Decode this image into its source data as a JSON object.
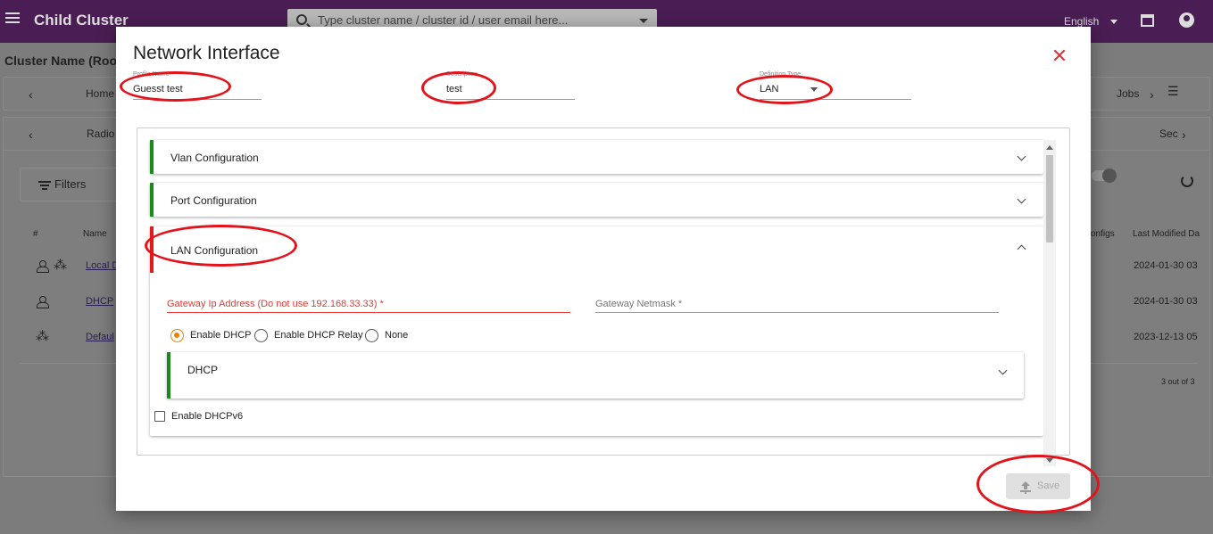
{
  "app": {
    "title": "Child Cluster",
    "search_placeholder": "Type cluster name / cluster id / user email here...",
    "language": "English"
  },
  "background": {
    "breadcrumb": "Cluster Name (Root)",
    "tabs_row1": {
      "first": "Home",
      "last": "Jobs"
    },
    "tabs_row2": {
      "first": "Radio",
      "last": "Sec"
    },
    "filters_label": "Filters",
    "columns": {
      "index": "#",
      "name": "Name",
      "configs": "onfigs",
      "last_modified": "Last Modified Da"
    },
    "rows": [
      {
        "name": "Local D",
        "date": "2024-01-30 03"
      },
      {
        "name": "DHCP",
        "date": "2024-01-30 03"
      },
      {
        "name": "Defaul",
        "date": "2023-12-13 05"
      }
    ],
    "pager": "3 out of 3"
  },
  "modal": {
    "title": "Network Interface",
    "fields": {
      "name": {
        "label": "Profile Name",
        "value": "Guesst test"
      },
      "description": {
        "label": "Description",
        "value": "test"
      },
      "type": {
        "label": "Definition Type",
        "value": "LAN"
      }
    },
    "sections": {
      "vlan": "Vlan Configuration",
      "port": "Port Configuration",
      "lan": "LAN Configuration"
    },
    "lan": {
      "gateway_ip_label": "Gateway Ip Address (Do not use 192.168.33.33) *",
      "gateway_netmask_label": "Gateway Netmask *",
      "radios": [
        "Enable DHCP",
        "Enable DHCP Relay",
        "None"
      ],
      "selected_radio": "Enable DHCP",
      "dhcp_section": "DHCP",
      "dhcpv6_label": "Enable DHCPv6"
    },
    "save_label": "Save"
  },
  "colors": {
    "topbar": "#4a1e54",
    "accent_green": "#1a8a1a",
    "accent_red": "#e01b1b",
    "radio_selected": "#f57c00",
    "annotation": "#e3131b"
  },
  "icons": [
    "menu-icon",
    "search-icon",
    "chevron-down-icon",
    "store-icon",
    "account-icon",
    "close-icon",
    "chevron-up-icon",
    "upload-icon",
    "refresh-icon",
    "filter-icon"
  ]
}
